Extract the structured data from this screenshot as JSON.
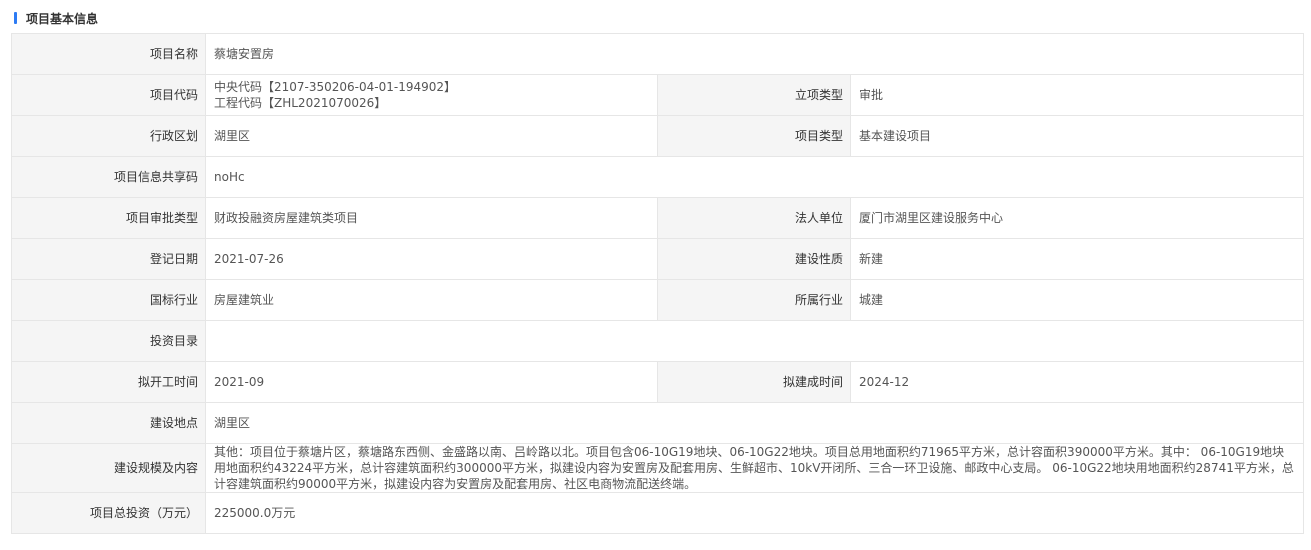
{
  "section": {
    "title": "项目基本信息"
  },
  "rows": {
    "name": {
      "label": "项目名称",
      "value": "蔡塘安置房"
    },
    "code": {
      "label": "项目代码",
      "line1": "中央代码【2107-350206-04-01-194902】",
      "line2": "工程代码【ZHL2021070026】",
      "label2": "立项类型",
      "value2": "审批"
    },
    "region": {
      "label": "行政区划",
      "value": "湖里区",
      "label2": "项目类型",
      "value2": "基本建设项目"
    },
    "share_code": {
      "label": "项目信息共享码",
      "value": "noHc"
    },
    "approval_type": {
      "label": "项目审批类型",
      "value": "财政投融资房屋建筑类项目",
      "label2": "法人单位",
      "value2": "厦门市湖里区建设服务中心"
    },
    "reg_date": {
      "label": "登记日期",
      "value": "2021-07-26",
      "label2": "建设性质",
      "value2": "新建"
    },
    "industry": {
      "label": "国标行业",
      "value": "房屋建筑业",
      "label2": "所属行业",
      "value2": "城建"
    },
    "catalog": {
      "label": "投资目录",
      "value": ""
    },
    "start": {
      "label": "拟开工时间",
      "value": "2021-09",
      "label2": "拟建成时间",
      "value2": "2024-12"
    },
    "location": {
      "label": "建设地点",
      "value": "湖里区"
    },
    "scale": {
      "label": "建设规模及内容",
      "value": "其他：项目位于蔡塘片区，蔡塘路东西侧、金盛路以南、吕岭路以北。项目包含06-10G19地块、06-10G22地块。项目总用地面积约71965平方米，总计容面积390000平方米。其中： 06-10G19地块用地面积约43224平方米，总计容建筑面积约300000平方米，拟建设内容为安置房及配套用房、生鲜超市、10kV开闭所、三合一环卫设施、邮政中心支局。 06-10G22地块用地面积约28741平方米，总计容建筑面积约90000平方米，拟建设内容为安置房及配套用房、社区电商物流配送终端。"
    },
    "investment": {
      "label": "项目总投资（万元）",
      "value": "225000.0万元"
    }
  }
}
